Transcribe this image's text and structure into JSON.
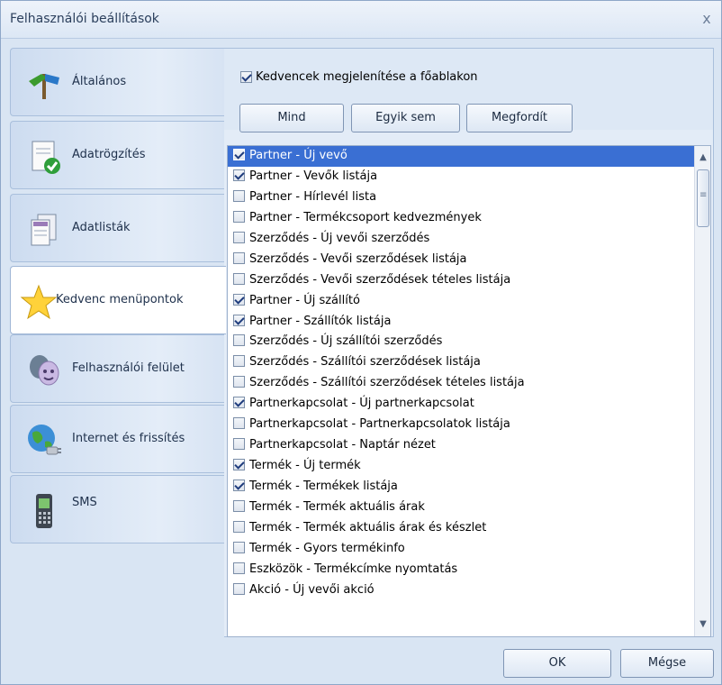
{
  "window": {
    "title": "Felhasználói beállítások",
    "close_glyph": "x"
  },
  "sidebar": {
    "items": [
      {
        "label": "Általános",
        "icon": "signpost-icon",
        "active": false
      },
      {
        "label": "Adatrögzítés",
        "icon": "document-check-icon",
        "active": false
      },
      {
        "label": "Adatlisták",
        "icon": "documents-icon",
        "active": false
      },
      {
        "label": "Kedvenc menüpontok",
        "icon": "star-icon",
        "active": true
      },
      {
        "label": "Felhasználói felület",
        "icon": "theater-masks-icon",
        "active": false
      },
      {
        "label": "Internet és frissítés",
        "icon": "globe-plug-icon",
        "active": false
      },
      {
        "label": "SMS",
        "icon": "mobile-phone-icon",
        "active": false
      }
    ]
  },
  "favorites": {
    "show_label": "Kedvencek megjelenítése a főablakon",
    "show_checked": true,
    "buttons": {
      "all": "Mind",
      "none": "Egyik sem",
      "invert": "Megfordít"
    },
    "items": [
      {
        "label": "Partner - Új vevő",
        "checked": true,
        "selected": true
      },
      {
        "label": "Partner - Vevők listája",
        "checked": true,
        "selected": false
      },
      {
        "label": "Partner - Hírlevél lista",
        "checked": false,
        "selected": false
      },
      {
        "label": "Partner - Termékcsoport kedvezmények",
        "checked": false,
        "selected": false
      },
      {
        "label": "Szerződés - Új vevői szerződés",
        "checked": false,
        "selected": false
      },
      {
        "label": "Szerződés - Vevői szerződések listája",
        "checked": false,
        "selected": false
      },
      {
        "label": "Szerződés - Vevői szerződések tételes listája",
        "checked": false,
        "selected": false
      },
      {
        "label": "Partner - Új szállító",
        "checked": true,
        "selected": false
      },
      {
        "label": "Partner - Szállítók listája",
        "checked": true,
        "selected": false
      },
      {
        "label": "Szerződés - Új szállítói szerződés",
        "checked": false,
        "selected": false
      },
      {
        "label": "Szerződés - Szállítói szerződések listája",
        "checked": false,
        "selected": false
      },
      {
        "label": "Szerződés - Szállítói szerződések tételes listája",
        "checked": false,
        "selected": false
      },
      {
        "label": "Partnerkapcsolat - Új partnerkapcsolat",
        "checked": true,
        "selected": false
      },
      {
        "label": "Partnerkapcsolat - Partnerkapcsolatok listája",
        "checked": false,
        "selected": false
      },
      {
        "label": "Partnerkapcsolat - Naptár nézet",
        "checked": false,
        "selected": false
      },
      {
        "label": "Termék - Új termék",
        "checked": true,
        "selected": false
      },
      {
        "label": "Termék - Termékek listája",
        "checked": true,
        "selected": false
      },
      {
        "label": "Termék - Termék aktuális árak",
        "checked": false,
        "selected": false
      },
      {
        "label": "Termék - Termék aktuális árak és készlet",
        "checked": false,
        "selected": false
      },
      {
        "label": "Termék - Gyors termékinfo",
        "checked": false,
        "selected": false
      },
      {
        "label": "Eszközök - Termékcímke nyomtatás",
        "checked": false,
        "selected": false
      },
      {
        "label": "Akció - Új vevői akció",
        "checked": false,
        "selected": false
      }
    ]
  },
  "footer": {
    "ok": "OK",
    "cancel": "Mégse"
  },
  "colors": {
    "selection": "#3a6fd3",
    "window_bg": "#d9e5f3"
  }
}
